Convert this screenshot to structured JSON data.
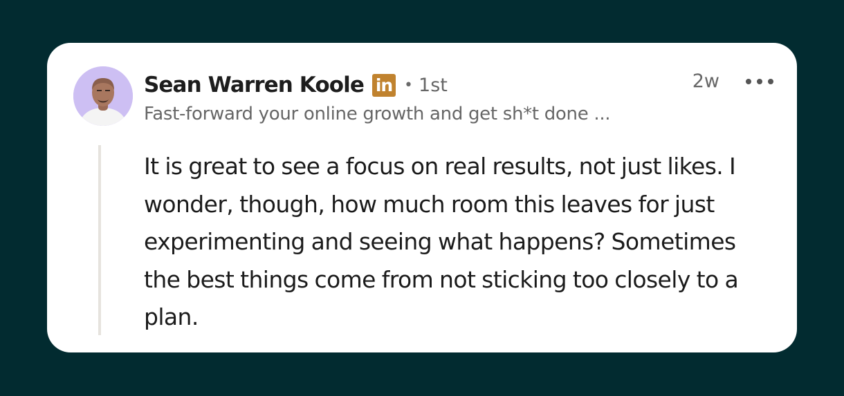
{
  "comment": {
    "author": {
      "name": "Sean Warren Koole",
      "badge": "in",
      "separator": "•",
      "degree": "1st",
      "headline": "Fast-forward your online growth and get sh*t done ...",
      "avatar_icon": "profile-photo"
    },
    "timestamp": "2w",
    "more_icon": "ellipsis-horizontal-icon",
    "text": "It is great to see a focus on real results, not just likes. I wonder, though, how much room this leaves for just experimenting and seeing what happens? Sometimes the best things come from not sticking too closely to a plan."
  },
  "colors": {
    "background": "#022b30",
    "card": "#ffffff",
    "badge": "#c0822e",
    "avatar_bg": "#cdbff3",
    "text_primary": "#1b1b1b",
    "text_secondary": "#666666"
  }
}
